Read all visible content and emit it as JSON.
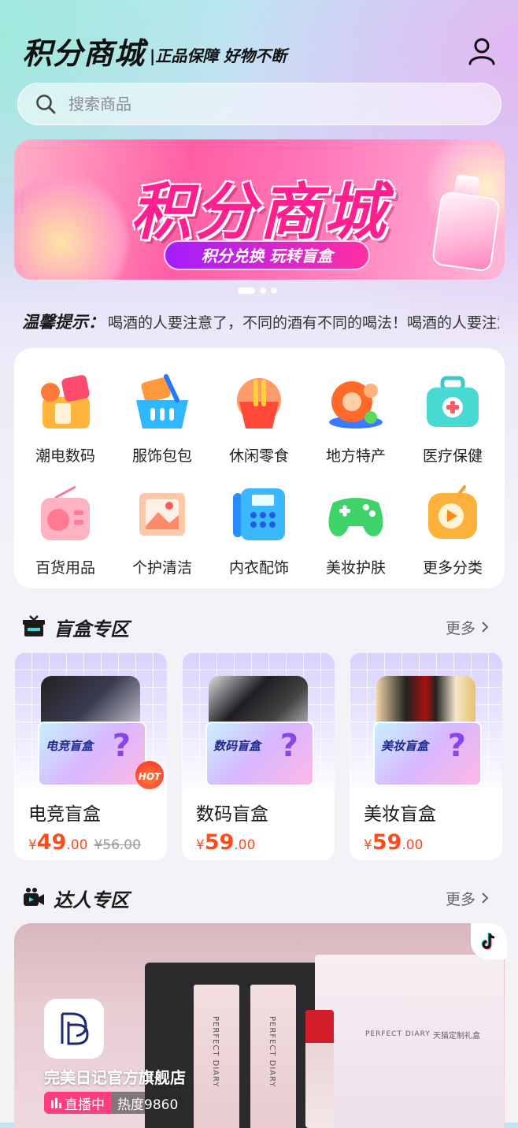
{
  "header": {
    "title": "积分商城",
    "slogan": "|正品保障  好物不断"
  },
  "search": {
    "placeholder": "搜索商品"
  },
  "banner": {
    "title": "积分商城",
    "subtitle": "积分兑换  玩转盲盒"
  },
  "tip": {
    "label": "温馨提示：",
    "text": "喝酒的人要注意了，不同的酒有不同的喝法！喝酒的人要注意了，不同的酒有不同的喝法！"
  },
  "categories": [
    {
      "label": "潮电数码",
      "icon": "digital-icon"
    },
    {
      "label": "服饰包包",
      "icon": "basket-icon"
    },
    {
      "label": "休闲零食",
      "icon": "snack-icon"
    },
    {
      "label": "地方特产",
      "icon": "specialty-icon"
    },
    {
      "label": "医疗保健",
      "icon": "medical-kit-icon"
    },
    {
      "label": "百货用品",
      "icon": "radio-icon"
    },
    {
      "label": "个护清洁",
      "icon": "picture-icon"
    },
    {
      "label": "内衣配饰",
      "icon": "phone-icon"
    },
    {
      "label": "美妆护肤",
      "icon": "gamepad-icon"
    },
    {
      "label": "更多分类",
      "icon": "play-icon"
    }
  ],
  "blindbox": {
    "title": "盲盒专区",
    "more": "更多",
    "items": [
      {
        "name": "电竞盲盒",
        "box_label": "电竞盲盒",
        "currency": "¥",
        "price_int": "49",
        "price_dec": ".00",
        "old_price": "¥56.00",
        "badge": "HOT"
      },
      {
        "name": "数码盲盒",
        "box_label": "数码盲盒",
        "currency": "¥",
        "price_int": "59",
        "price_dec": ".00",
        "old_price": ""
      },
      {
        "name": "美妆盲盒",
        "box_label": "美妆盲盒",
        "currency": "¥",
        "price_int": "59",
        "price_dec": ".00",
        "old_price": ""
      }
    ]
  },
  "creator": {
    "title": "达人专区",
    "more": "更多",
    "store_name": "完美日记官方旗舰店",
    "live_label": "直播中",
    "heat": "热度9860",
    "product_text_1": "PERFECT DIARY",
    "product_text_2": "PERFECT DIARY",
    "box_brand": "PERFECT DIARY",
    "box_brand_2": "天猫定制礼盒"
  },
  "colors": {
    "price": "#ff4a1c",
    "live": "#ff3d7f",
    "banner_pink": "#ff1f8f"
  }
}
